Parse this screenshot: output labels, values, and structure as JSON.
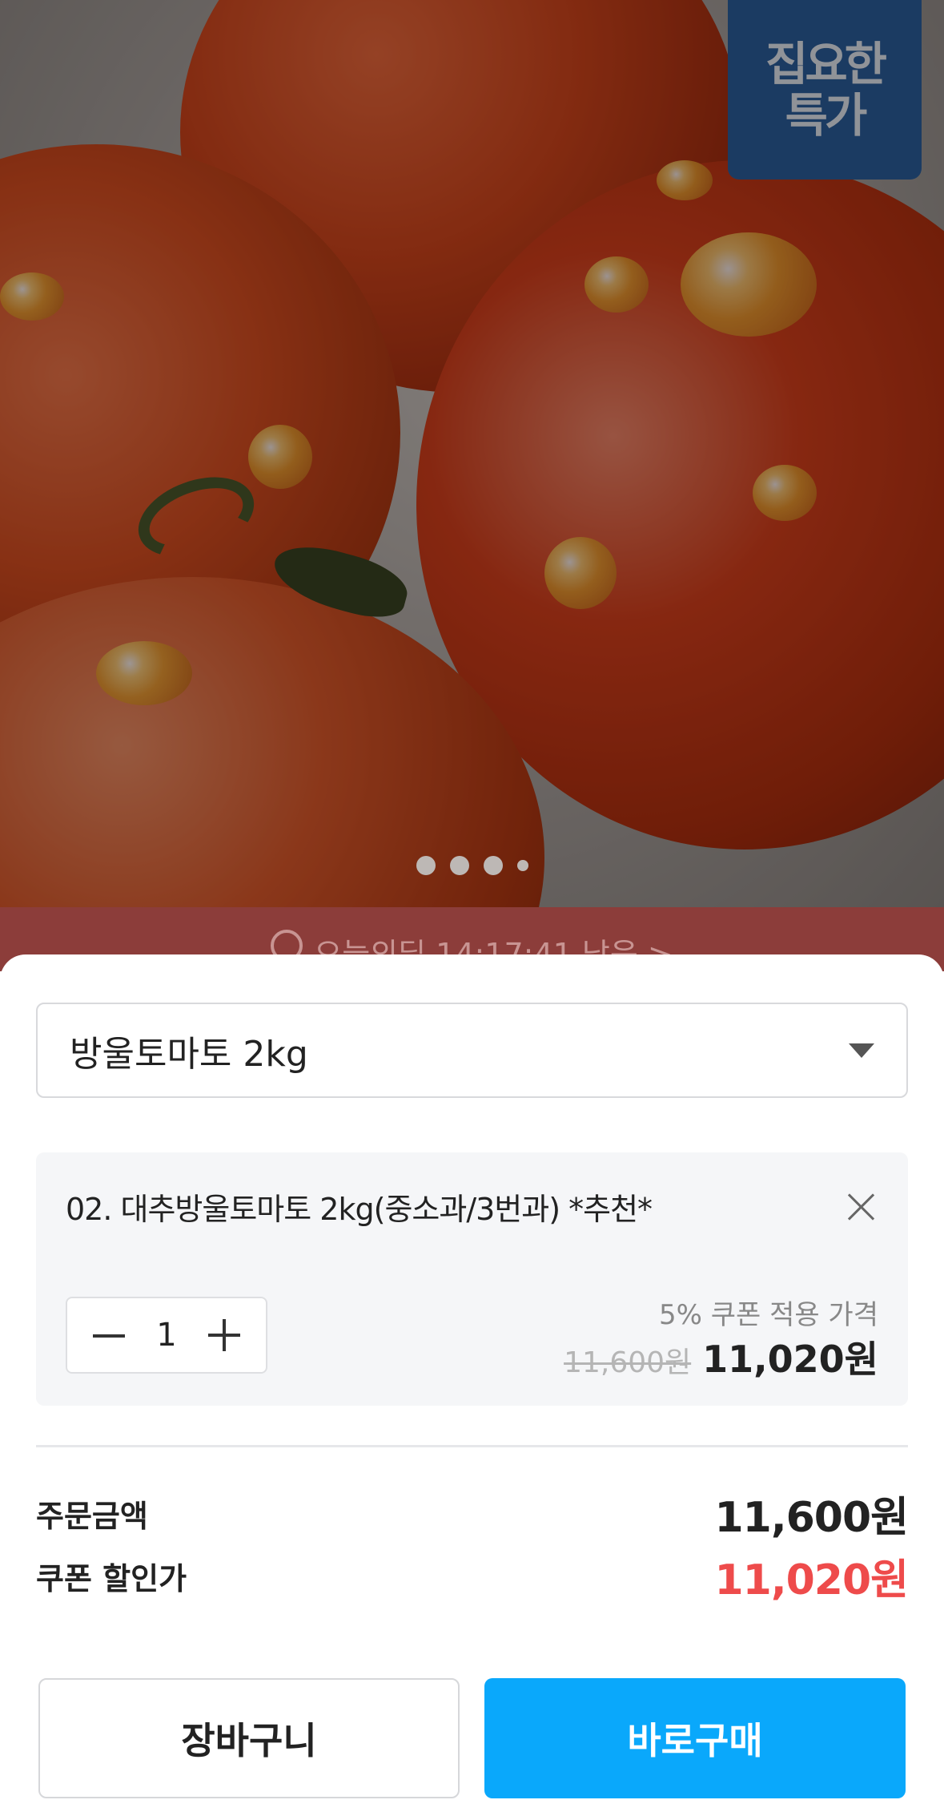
{
  "hero": {
    "badge_line1": "집요한",
    "badge_line2": "특가",
    "carousel_dots": 4,
    "timer_text": "오늘의딜  14:17:41 남음  >"
  },
  "option_select": {
    "selected": "방울토마토 2kg"
  },
  "selected_option": {
    "name": "02. 대추방울토마토 2kg(중소과/3번과) *추천*",
    "quantity": "1",
    "coupon_label": "5% 쿠폰 적용 가격",
    "original_price": "11,600원",
    "final_price": "11,020원"
  },
  "summary": {
    "order_amount_label": "주문금액",
    "order_amount_value": "11,600원",
    "coupon_price_label": "쿠폰 할인가",
    "coupon_price_value": "11,020원"
  },
  "actions": {
    "cart_label": "장바구니",
    "buy_label": "바로구매"
  },
  "colors": {
    "accent_blue": "#0aa8fb",
    "discount_red": "#ee4b4b",
    "badge_blue": "#2d5f9e"
  }
}
